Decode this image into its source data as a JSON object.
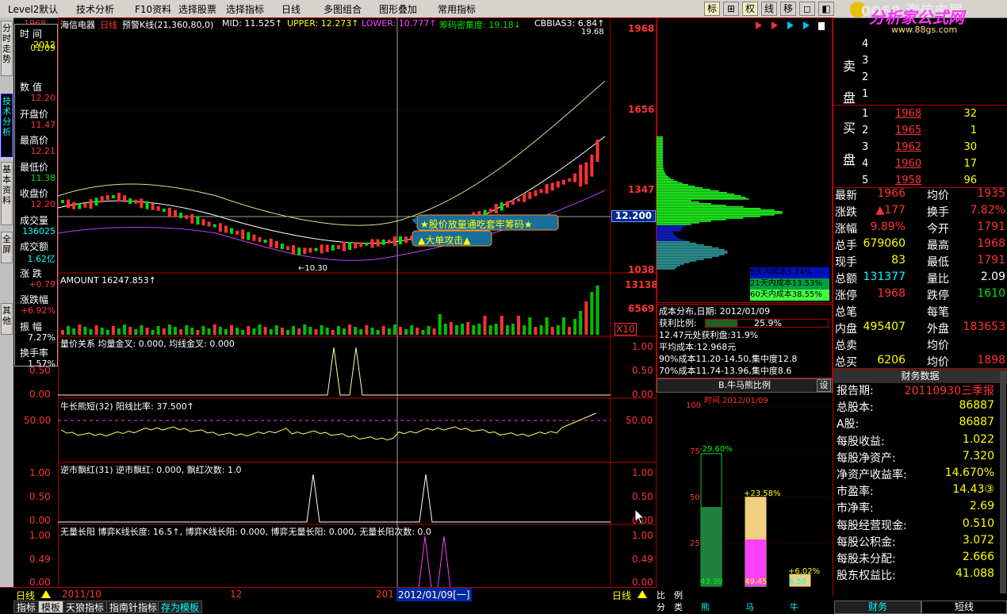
{
  "menubar": {
    "items": [
      "Level2默认",
      "技术分析",
      "F10资料",
      "选择股票",
      "选择指标",
      "日线",
      "多图组合",
      "图形叠加",
      "常用指标"
    ],
    "right_buttons": [
      "标",
      "⊞",
      "权",
      "线",
      "移",
      "◻",
      "◧"
    ],
    "logo_text": "分析家公式网",
    "logo_url": "www.88gs.com",
    "stock_title": "0069 海信电器"
  },
  "left_tabs": [
    "分时走势",
    "技术分析",
    "基本资料",
    "全屏",
    "其他"
  ],
  "data_window": {
    "rows": [
      {
        "label": "时 间",
        "value": "2012"
      },
      {
        "label": "",
        "value": "01/09"
      },
      {
        "label": "数 值",
        "value": "12.20"
      },
      {
        "label": "开盘价",
        "value": "11.47"
      },
      {
        "label": "最高价",
        "value": "12.21"
      },
      {
        "label": "最低价",
        "value": "11.38"
      },
      {
        "label": "收盘价",
        "value": "12.20"
      },
      {
        "label": "成交量",
        "value": "136025"
      },
      {
        "label": "成交额",
        "value": "1.62亿"
      },
      {
        "label": "涨 跌",
        "value": "+0.79"
      },
      {
        "label": "涨跌幅",
        "value": "+6.92%"
      },
      {
        "label": "振 幅",
        "value": "7.27%"
      },
      {
        "label": "换手率",
        "value": "1.57%"
      }
    ]
  },
  "main_chart": {
    "header": {
      "name": "海信电器",
      "period": "日线",
      "indicator": "预警K线(21,360,80,0)",
      "mid": "MID: 11.525↑",
      "upper": "UPPER: 12.273↑",
      "lower": "LOWER: 10.777↑",
      "chip": "筹码密集度: 19.18↓",
      "cbbias": "CBBIAS3: 6.84↑"
    },
    "right_scale": [
      "1968",
      "1656",
      "1347",
      "1038"
    ],
    "price_tag": "12.200",
    "high_label": "19.68",
    "low_label": "←10.30",
    "signal1": "★股价放量通吃套牢筹码★",
    "signal2": "▲大单攻击▲",
    "left_top": "1968"
  },
  "amount_panel": {
    "header": "AMOUNT 16247.853↑",
    "scale": [
      "13138",
      "6569"
    ],
    "x10": "X10"
  },
  "panel_qty": {
    "header": "量价关系 均量金叉: 0.000, 均线金叉: 0.000",
    "scale": [
      "1.00",
      "0.50",
      "0.00"
    ]
  },
  "panel_bull": {
    "header": "牛长熊短(32) 阳线比率: 37.500↑",
    "scale": [
      "50.00"
    ]
  },
  "panel_red": {
    "header": "逆市飘红(31) 逆市飘红: 0.000, 飘红次数: 1.0",
    "scale": [
      "1.00",
      "0.50",
      "0.00"
    ]
  },
  "panel_long": {
    "header": "无量长阳 博弈K线长度: 16.5↑, 博弈K线长阳: 0.000, 博弈无量长阳: 0.000, 无量长阳次数: 0.0",
    "scale": [
      "1.00",
      "0.49",
      "0.00"
    ]
  },
  "x_axis": {
    "labels": [
      "2011/10",
      "12",
      "201"
    ],
    "cursor_date": "2012/01/09[一]",
    "period": "日线"
  },
  "cost_panel": {
    "legend": [
      "5天内成本5.74%",
      "21天内成本13.53%",
      "60天内成本38.55%"
    ],
    "info_title": "成本分布,日期: 2012/01/09",
    "profit_label": "获利比例:",
    "profit_value": "25.9%",
    "line1": "12.47元处获利盘:31.9%",
    "line2": "平均成本:12.968元",
    "line3": "90%成本11.20-14.50,集中度12.8",
    "line4": "70%成本11.74-13.96,集中度8.6"
  },
  "bull_bear": {
    "title": "B.牛马熊比例",
    "settings": "设",
    "date": "时间 2012/01/09",
    "scale": [
      "100",
      "75",
      "50",
      "25",
      "0"
    ],
    "bars": [
      {
        "name": "熊",
        "value": "43.99",
        "change": "-29.60%"
      },
      {
        "name": "马",
        "value": "49.45",
        "change": "+23.58%"
      },
      {
        "name": "牛",
        "value": "6.56",
        "change": "+6.02%"
      }
    ],
    "side_label_1": "比分",
    "side_label_2": "例类"
  },
  "orderbook": {
    "sell_label": "卖盘",
    "buy_label": "买盘",
    "sell": [
      {
        "n": "4"
      },
      {
        "n": "3"
      },
      {
        "n": "2"
      },
      {
        "n": "1"
      }
    ],
    "buy": [
      {
        "n": "1",
        "price": "1968",
        "vol": "32"
      },
      {
        "n": "2",
        "price": "1965",
        "vol": "1"
      },
      {
        "n": "3",
        "price": "1962",
        "vol": "30"
      },
      {
        "n": "4",
        "price": "1960",
        "vol": "17"
      },
      {
        "n": "5",
        "price": "1958",
        "vol": "96"
      }
    ]
  },
  "quote": [
    {
      "l": "最新",
      "v": "1966",
      "l2": "均价",
      "v2": "1935"
    },
    {
      "l": "涨跌",
      "v": "▲177",
      "l2": "换手",
      "v2": "7.82%"
    },
    {
      "l": "涨幅",
      "v": "9.89%",
      "l2": "今开",
      "v2": "1791"
    },
    {
      "l": "总手",
      "v": "679060",
      "l2": "最高",
      "v2": "1968"
    },
    {
      "l": "现手",
      "v": "83",
      "l2": "最低",
      "v2": "1791"
    },
    {
      "l": "总额",
      "v": "131377",
      "l2": "量比",
      "v2": "2.09"
    },
    {
      "l": "涨停",
      "v": "1968",
      "l2": "跌停",
      "v2": "1610"
    },
    {
      "l": "总笔",
      "v": "",
      "l2": "每笔",
      "v2": ""
    },
    {
      "l": "内盘",
      "v": "495407",
      "l2": "外盘",
      "v2": "183653"
    },
    {
      "l": "总卖",
      "v": "",
      "l2": "均价",
      "v2": ""
    },
    {
      "l": "总买",
      "v": "6206",
      "l2": "均价",
      "v2": "1898"
    }
  ],
  "finance": {
    "title": "财务数据",
    "rows": [
      {
        "l": "报告期:",
        "v": "20110930三季报"
      },
      {
        "l": "总股本:",
        "v": "86887"
      },
      {
        "l": "A股:",
        "v": "86887"
      },
      {
        "l": "每股收益:",
        "v": "1.022"
      },
      {
        "l": "每股净资产:",
        "v": "7.320"
      },
      {
        "l": "净资产收益率:",
        "v": "14.670%"
      },
      {
        "l": "市盈率:",
        "v": "14.43③"
      },
      {
        "l": "市净率:",
        "v": "2.69"
      },
      {
        "l": "每股经营现金:",
        "v": "0.510"
      },
      {
        "l": "每股公积金:",
        "v": "3.072"
      },
      {
        "l": "每股未分配:",
        "v": "2.666"
      },
      {
        "l": "股东权益比:",
        "v": "41.088"
      }
    ],
    "tab_finance": "财务",
    "tab_short": "短线"
  },
  "bottom_tabs": [
    "指标",
    "模板",
    "天狼指标",
    "指南针指标",
    "存为模板"
  ],
  "colors": {
    "up": "#ff3232",
    "down": "#00e000",
    "axis": "#b00000",
    "yellow": "#ffff00",
    "cyan": "#00ffff",
    "magenta": "#ff40ff"
  }
}
